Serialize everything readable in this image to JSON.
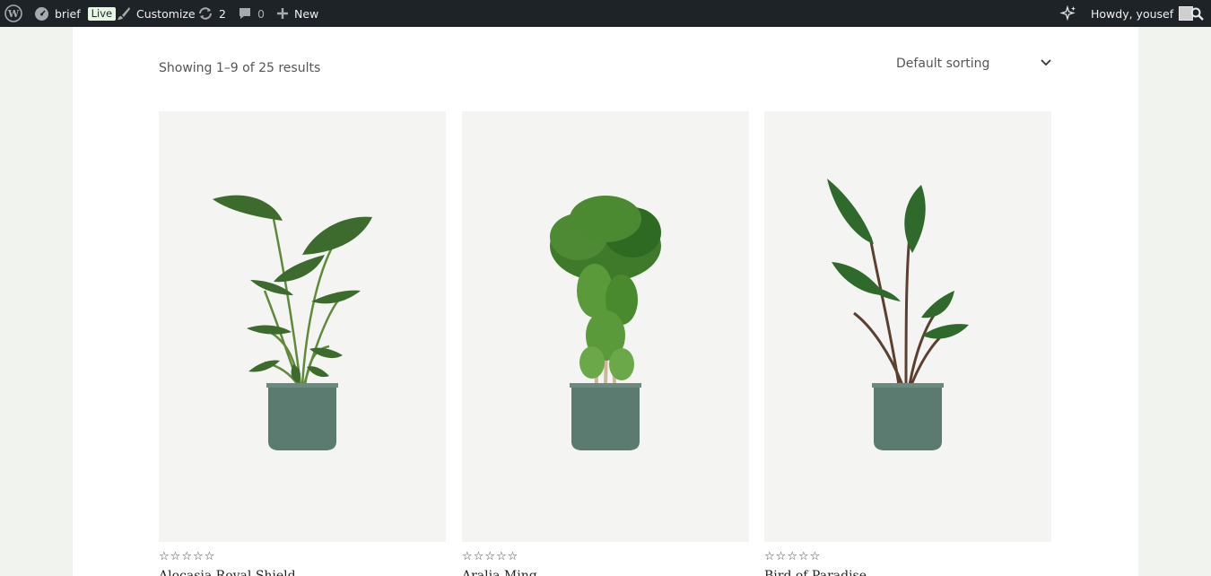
{
  "admin_bar": {
    "wp_icon": "wordpress-logo-icon",
    "site_name": "brief",
    "live_badge": "Live",
    "customize_label": "Customize",
    "updates_count": "2",
    "comments_count": "0",
    "new_label": "New",
    "ai_icon": "sparkles-icon",
    "greeting": "Howdy, yousef",
    "search_icon": "search-icon"
  },
  "shop": {
    "result_count": "Showing 1–9 of 25 results",
    "sorting": {
      "selected": "Default sorting"
    }
  },
  "products": [
    {
      "name": "Alocasia Royal Shield",
      "rating": 0
    },
    {
      "name": "Aralia Ming",
      "rating": 0
    },
    {
      "name": "Bird of Paradise",
      "rating": 0
    }
  ],
  "colors": {
    "admin_bar_bg": "#1d2327",
    "page_bg": "#f1f3ef",
    "card_bg": "#f4f5f2",
    "pot": "#5b7a70",
    "leaf": "#3d6b2e"
  }
}
